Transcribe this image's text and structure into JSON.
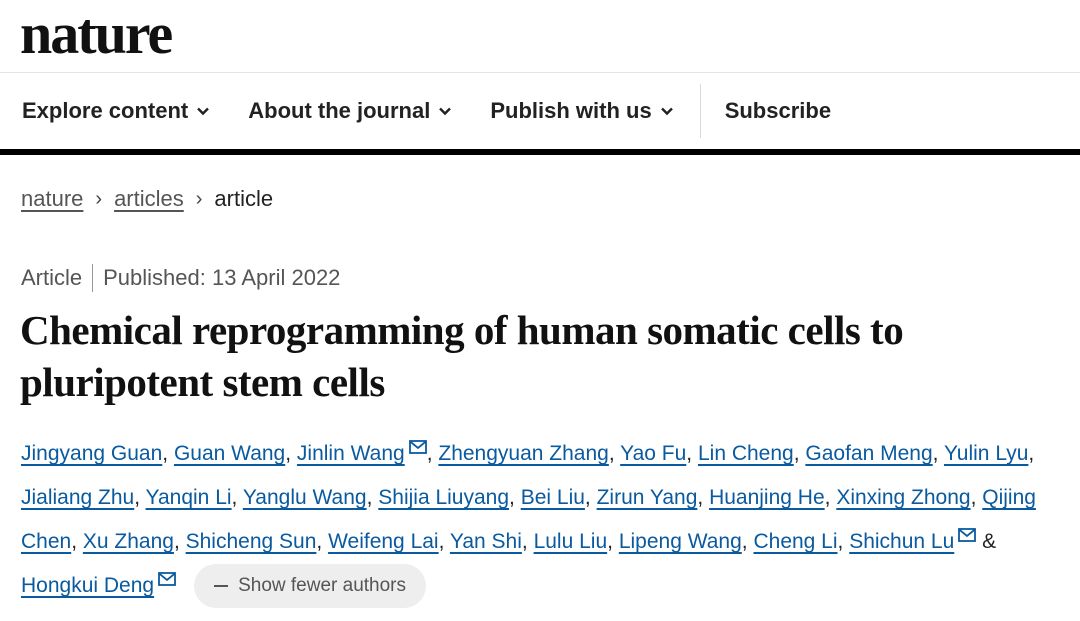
{
  "brand": {
    "logo_text": "nature"
  },
  "nav": {
    "items": [
      {
        "label": "Explore content",
        "icon": "chevron-down-icon"
      },
      {
        "label": "About the journal",
        "icon": "chevron-down-icon"
      },
      {
        "label": "Publish with us",
        "icon": "chevron-down-icon"
      }
    ],
    "subscribe": "Subscribe"
  },
  "breadcrumb": {
    "items": [
      "nature",
      "articles",
      "article"
    ],
    "separator": "›"
  },
  "article": {
    "type": "Article",
    "published": "Published: 13 April 2022",
    "title": "Chemical reprogramming of human somatic cells to pluripotent stem cells",
    "authors": [
      "Jingyang Guan",
      "Guan Wang",
      "Jinlin Wang",
      "Zhengyuan Zhang",
      "Yao Fu",
      "Lin Cheng",
      "Gaofan Meng",
      "Yulin Lyu",
      "Jialiang Zhu",
      "Yanqin Li",
      "Yanglu Wang",
      "Shijia Liuyang",
      "Bei Liu",
      "Zirun Yang",
      "Huanjing He",
      "Xinxing Zhong",
      "Qijing Chen",
      "Xu Zhang",
      "Shicheng Sun",
      "Weifeng Lai",
      "Yan Shi",
      "Lulu Liu",
      "Lipeng Wang",
      "Cheng Li",
      "Shichun Lu",
      "Hongkui Deng"
    ],
    "author_separator": ", ",
    "last_author_separator": " & ",
    "show_fewer_label": "Show fewer authors"
  },
  "colors": {
    "link": "#0a5aa0",
    "nav_border": "#000000",
    "pill_bg": "#eeeeee"
  }
}
